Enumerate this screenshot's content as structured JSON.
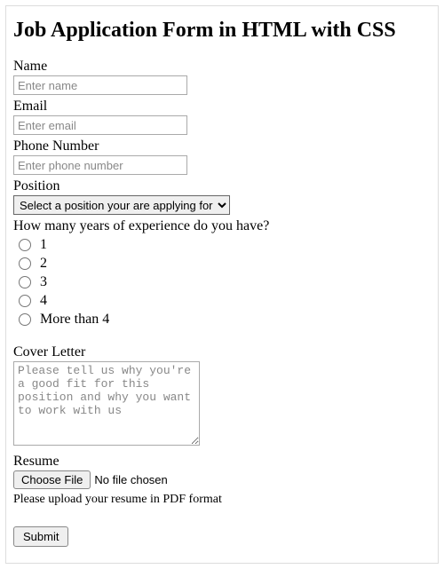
{
  "title": "Job Application Form in HTML with CSS",
  "name": {
    "label": "Name",
    "placeholder": "Enter name"
  },
  "email": {
    "label": "Email",
    "placeholder": "Enter email"
  },
  "phone": {
    "label": "Phone Number",
    "placeholder": "Enter phone number"
  },
  "position": {
    "label": "Position",
    "selected": "Select a position your are applying for"
  },
  "experience": {
    "label": "How many years of experience do you have?",
    "options": [
      "1",
      "2",
      "3",
      "4",
      "More than 4"
    ]
  },
  "cover": {
    "label": "Cover Letter",
    "placeholder": "Please tell us why you're a good fit for this position and why you want to work with us"
  },
  "resume": {
    "label": "Resume",
    "button": "Choose File",
    "status": "No file chosen",
    "hint": "Please upload your resume in PDF format"
  },
  "submit": "Submit"
}
